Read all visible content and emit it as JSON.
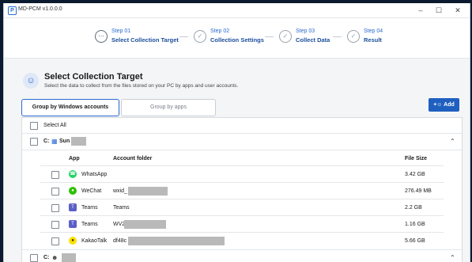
{
  "window": {
    "title": "MD-PCM v1.0.0.0",
    "controls": {
      "minimize": "–",
      "maximize": "☐",
      "close": "✕"
    }
  },
  "steps": [
    {
      "num": "Step 01",
      "name": "Select Collection Target",
      "symbol": "⋯"
    },
    {
      "num": "Step 02",
      "name": "Collection Settings",
      "symbol": "✓"
    },
    {
      "num": "Step 03",
      "name": "Collect Data",
      "symbol": "✓"
    },
    {
      "num": "Step 04",
      "name": "Result",
      "symbol": "✓"
    }
  ],
  "header": {
    "title": "Select Collection Target",
    "subtitle": "Select the data to collect from the files stored on your PC by apps and user accounts.",
    "icon": "user-icon"
  },
  "tabs": [
    {
      "label": "Group by Windows accounts",
      "active": true
    },
    {
      "label": "Group by apps",
      "active": false
    }
  ],
  "add_button": {
    "label": "Add",
    "icon": "add-user-icon"
  },
  "select_all": "Select All",
  "accounts": [
    {
      "drive": "C:",
      "name": "Sun",
      "icon": "user-folder-icon"
    },
    {
      "drive": "C:",
      "name": "",
      "icon": "user-icon"
    }
  ],
  "table": {
    "headers": {
      "app": "App",
      "folder": "Account folder",
      "size": "File Size"
    },
    "rows": [
      {
        "app": "WhatsApp",
        "folder": "",
        "size": "3.42 GB",
        "icon": "whatsapp-icon",
        "color": "#25d366"
      },
      {
        "app": "WeChat",
        "folder": "wxid_",
        "size": "276.49 MB",
        "icon": "wechat-icon",
        "color": "#2dc100"
      },
      {
        "app": "Teams",
        "folder": "Teams",
        "size": "2.2 GB",
        "icon": "teams-icon",
        "color": "#5b5fc7"
      },
      {
        "app": "Teams",
        "folder": "WV2",
        "size": "1.16 GB",
        "icon": "teams-icon",
        "color": "#5b5fc7"
      },
      {
        "app": "KakaoTalk",
        "folder": "df48c",
        "size": "5.66 GB",
        "icon": "kakaotalk-icon",
        "color": "#fae100"
      }
    ]
  },
  "colors": {
    "accent": "#1f5fbf",
    "step_text": "#1c4f9c"
  }
}
